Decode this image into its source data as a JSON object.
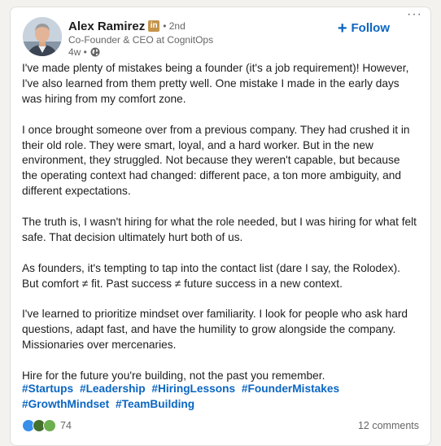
{
  "author": {
    "name": "Alex Ramirez",
    "badge": "in",
    "degree": "• 2nd",
    "headline": "Co-Founder & CEO at CognitOps",
    "time": "4w •"
  },
  "follow_label": "Follow",
  "body": {
    "p1": "I've made plenty of mistakes being a founder (it's a job requirement)! However, I've also learned from them pretty well. One mistake I made in the early days was hiring from my comfort zone.",
    "p2": "I once brought someone over from a previous company. They had crushed it in their old role. They were smart, loyal, and a hard worker. But in the new environment, they struggled. Not because they weren't capable, but because the operating context had changed: different pace, a ton more ambiguity, and different expectations.",
    "p3": "The truth is, I wasn't hiring for what the role needed, but I was hiring for what felt safe. That decision ultimately hurt both of us.",
    "p4": "As founders, it's tempting to tap into the contact list (dare I say, the Rolodex). But comfort ≠ fit. Past success ≠ future success in a new context.",
    "p5": "I've learned to prioritize mindset over familiarity. I look for people who ask hard questions, adapt fast, and have the humility to grow alongside the company. Missionaries over mercenaries.",
    "p6": "Hire for the future you're building, not the past you remember."
  },
  "hashtags": [
    "#Startups",
    "#Leadership",
    "#HiringLessons",
    "#FounderMistakes",
    "#GrowthMindset",
    "#TeamBuilding"
  ],
  "reactions": {
    "count": "74",
    "icons": [
      "like-icon",
      "celebrate-icon",
      "support-icon"
    ]
  },
  "comments_label": "12 comments",
  "colors": {
    "accent": "#0a66c2",
    "badge": "#c4944a",
    "like": "#378fe9",
    "celebrate": "#44712e",
    "support": "#6dae4f"
  }
}
